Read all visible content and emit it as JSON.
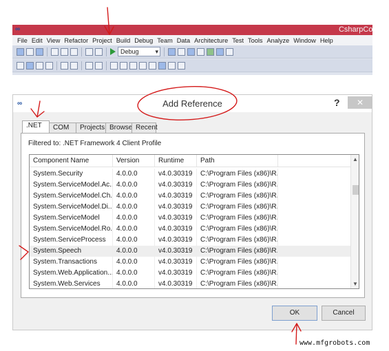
{
  "vs_window": {
    "title": "CsharpCoc",
    "menu": [
      "File",
      "Edit",
      "View",
      "Refactor",
      "Project",
      "Build",
      "Debug",
      "Team",
      "Data",
      "Architecture",
      "Test",
      "Tools",
      "Analyze",
      "Window",
      "Help"
    ],
    "config_combo": "Debug"
  },
  "dialog": {
    "title": "Add Reference",
    "help_glyph": "?",
    "close_glyph": "✕",
    "tabs": [
      ".NET",
      "COM",
      "Projects",
      "Browse",
      "Recent"
    ],
    "active_tab": ".NET",
    "filter_text": "Filtered to: .NET Framework 4 Client Profile",
    "columns": [
      "Component Name",
      "Version",
      "Runtime",
      "Path"
    ],
    "rows": [
      {
        "name": "System.Security",
        "version": "4.0.0.0",
        "runtime": "v4.0.30319",
        "path": "C:\\Program Files (x86)\\R..."
      },
      {
        "name": "System.ServiceModel.Ac...",
        "version": "4.0.0.0",
        "runtime": "v4.0.30319",
        "path": "C:\\Program Files (x86)\\R..."
      },
      {
        "name": "System.ServiceModel.Ch...",
        "version": "4.0.0.0",
        "runtime": "v4.0.30319",
        "path": "C:\\Program Files (x86)\\R..."
      },
      {
        "name": "System.ServiceModel.Di...",
        "version": "4.0.0.0",
        "runtime": "v4.0.30319",
        "path": "C:\\Program Files (x86)\\R..."
      },
      {
        "name": "System.ServiceModel",
        "version": "4.0.0.0",
        "runtime": "v4.0.30319",
        "path": "C:\\Program Files (x86)\\R..."
      },
      {
        "name": "System.ServiceModel.Ro...",
        "version": "4.0.0.0",
        "runtime": "v4.0.30319",
        "path": "C:\\Program Files (x86)\\R..."
      },
      {
        "name": "System.ServiceProcess",
        "version": "4.0.0.0",
        "runtime": "v4.0.30319",
        "path": "C:\\Program Files (x86)\\R..."
      },
      {
        "name": "System.Speech",
        "version": "4.0.0.0",
        "runtime": "v4.0.30319",
        "path": "C:\\Program Files (x86)\\R...",
        "highlighted": true
      },
      {
        "name": "System.Transactions",
        "version": "4.0.0.0",
        "runtime": "v4.0.30319",
        "path": "C:\\Program Files (x86)\\R..."
      },
      {
        "name": "System.Web.Application...",
        "version": "4.0.0.0",
        "runtime": "v4.0.30319",
        "path": "C:\\Program Files (x86)\\R..."
      },
      {
        "name": "System.Web.Services",
        "version": "4.0.0.0",
        "runtime": "v4.0.30319",
        "path": "C:\\Program Files (x86)\\R..."
      }
    ],
    "ok_label": "OK",
    "cancel_label": "Cancel"
  },
  "annotation_color": "#d41a1a",
  "watermark": "www.mfgrobots.com"
}
